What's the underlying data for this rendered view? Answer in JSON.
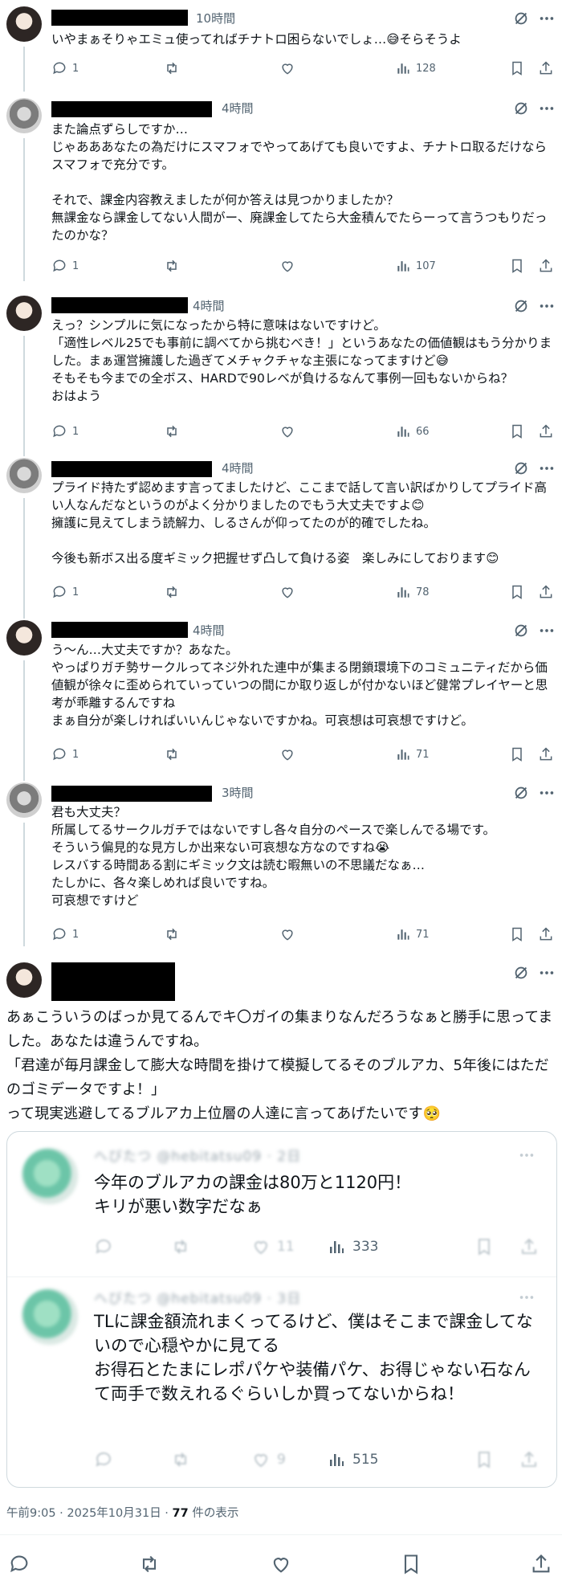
{
  "replies": [
    {
      "time": "10時間",
      "text": "いやまぁそりゃエミュ使ってればチナトロ困らないでしょ…😅そらそうよ",
      "replies": "1",
      "views": "128"
    },
    {
      "time": "4時間",
      "text": "また論点ずらしですか…\nじゃあああなたの為だけにスマフォでやってあげても良いですよ、チナトロ取るだけならスマフォで充分です。\n\nそれで、課金内容教えましたが何か答えは見つかりましたか？\n無課金なら課金してない人間がー、廃課金してたら大金積んでたらーって言うつもりだったのかな？",
      "replies": "1",
      "views": "107"
    },
    {
      "time": "4時間",
      "text": "えっ？シンプルに気になったから特に意味はないですけど。\n「適性レベル25でも事前に調べてから挑むべき！」というあなたの価値観はもう分かりました。まぁ運営擁護した過ぎてメチャクチャな主張になってますけど😅\nそもそも今までの全ボス、HARDで90レベが負けるなんて事例一回もないからね？\nおはよう",
      "replies": "1",
      "views": "66"
    },
    {
      "time": "4時間",
      "text": "プライド持たず認めます言ってましたけど、ここまで話して言い訳ばかりしてプライド高い人なんだなというのがよく分かりましたのでもう大丈夫ですよ😊\n擁護に見えてしまう読解力、しるさんが仰ってたのが的確でしたね。\n\n今後も新ボス出る度ギミック把握せず凸して負ける姿　楽しみにしております😊",
      "replies": "1",
      "views": "78"
    },
    {
      "time": "4時間",
      "text": "う～ん…大丈夫ですか？あなた。\nやっぱりガチ勢サークルってネジ外れた連中が集まる閉鎖環境下のコミュニティだから価値観が徐々に歪められていっていつの間にか取り返しが付かないほど健常プレイヤーと思考が乖離するんですね\nまぁ自分が楽しければいいんじゃないですかね。可哀想は可哀想ですけど。",
      "replies": "1",
      "views": "71"
    },
    {
      "time": "3時間",
      "text": "君も大丈夫？\n所属してるサークルガチではないですし各々自分のペースで楽しんでる場です。\nそういう偏見的な見方しか出来ない可哀想な方なのですね😭\nレスバする時間ある割にギミック文は読む暇無いの不思議だなぁ…\nたしかに、各々楽しめれば良いですね。\n可哀想ですけど",
      "replies": "1",
      "views": "71"
    }
  ],
  "main": {
    "text": "あぁこういうのばっか見てるんでキ〇ガイの集まりなんだろうなぁと勝手に思ってました。あなたは違うんですね。\n「君達が毎月課金して膨大な時間を掛けて模擬してるそのブルアカ、5年後にはただのゴミデータですよ！」\nって現実逃避してるブルアカ上位層の人達に言ってあげたいです🥺"
  },
  "quotes": [
    {
      "head": "へびたつ @hebitatsu09 · 2日",
      "text": "今年のブルアカの課金は80万と1120円！\nキリが悪い数字だなぁ",
      "likes": "11",
      "views": "333"
    },
    {
      "head": "へびたつ @hebitatsu09 · 3日",
      "text": "TLに課金額流れまくってるけど、僕はそこまで課金してないので心穏やかに見てる\nお得石とたまにレポパケや装備パケ、お得じゃない石なんて両手で数えれるぐらいしか買ってないからね！",
      "likes": "9",
      "views": "515"
    }
  ],
  "meta": {
    "datetime": "午前9:05 · 2025年10月31日 · ",
    "views": "77",
    "views_suffix": " 件の表示"
  },
  "icons": [
    "reply-icon",
    "retweet-icon",
    "like-icon",
    "views-icon",
    "bookmark-icon",
    "share-icon",
    "grok-icon",
    "more-icon"
  ]
}
